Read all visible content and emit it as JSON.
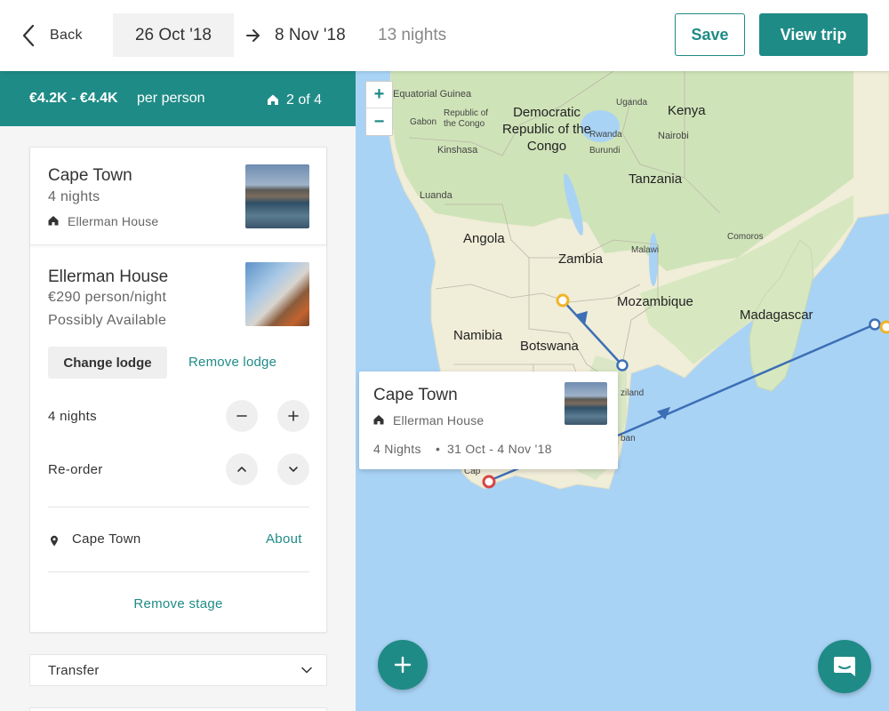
{
  "header": {
    "back_label": "Back",
    "start_date": "26 Oct '18",
    "end_date": "8 Nov '18",
    "nights": "13 nights",
    "save_label": "Save",
    "view_trip_label": "View trip"
  },
  "summary": {
    "price_range": "€4.2K - €4.4K",
    "per_person": "per person",
    "stage_count": "2 of 4"
  },
  "stage": {
    "title": "Cape Town",
    "nights": "4 nights",
    "lodge_name": "Ellerman House"
  },
  "lodge": {
    "title": "Ellerman House",
    "price": "€290 person/night",
    "availability": "Possibly Available",
    "change_label": "Change lodge",
    "remove_label": "Remove lodge"
  },
  "controls": {
    "nights_label": "4 nights",
    "reorder_label": "Re-order"
  },
  "location": {
    "name": "Cape Town",
    "about_label": "About"
  },
  "remove_stage_label": "Remove stage",
  "transfer_label": "Transfer",
  "map": {
    "zoom_in": "+",
    "zoom_out": "−",
    "labels": {
      "drc": "Democratic Republic of the Congo",
      "equatorial_guinea": "Equatorial Guinea",
      "gabon": "Gabon",
      "republic_congo": "Republic of the Congo",
      "kinshasa": "Kinshasa",
      "uganda": "Uganda",
      "kenya": "Kenya",
      "rwanda": "Rwanda",
      "burundi": "Burundi",
      "nairobi": "Nairobi",
      "tanzania": "Tanzania",
      "luanda": "Luanda",
      "angola": "Angola",
      "zambia": "Zambia",
      "malawi": "Malawi",
      "comoros": "Comoros",
      "mozambique": "Mozambique",
      "madagascar": "Madagascar",
      "namibia": "Namibia",
      "botswana": "Botswana",
      "swaziland": "ziland",
      "durban": "ban",
      "cape_town": "Cap"
    },
    "popup": {
      "title": "Cape Town",
      "lodge": "Ellerman House",
      "nights": "4 Nights",
      "dates": "31 Oct - 4 Nov '18"
    },
    "route_color": "#3d6fb6",
    "marker_yellow": "#f0b429",
    "marker_red": "#d64545"
  },
  "colors": {
    "accent": "#1f8b86",
    "water": "#a9d3f5",
    "land": "#f0edd8"
  }
}
